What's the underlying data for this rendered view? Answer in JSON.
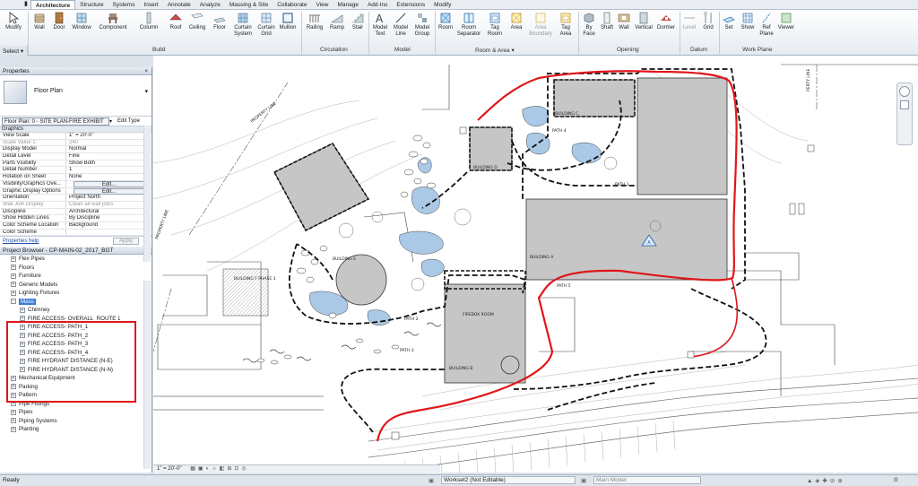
{
  "tabs": [
    "Architecture",
    "Structure",
    "Systems",
    "Insert",
    "Annotate",
    "Analyze",
    "Massing & Site",
    "Collaborate",
    "View",
    "Manage",
    "Add-Ins",
    "Extensions",
    "Modify"
  ],
  "ribbon": {
    "buttons": {
      "modify": "Modify",
      "wall": "Wall",
      "door": "Door",
      "window": "Window",
      "component": "Component",
      "column": "Column",
      "roof": "Roof",
      "ceiling": "Ceiling",
      "floor": "Floor",
      "curtain_system": "Curtain System",
      "curtain_grid": "Curtain Grid",
      "mullion": "Mullion",
      "railing": "Railing",
      "ramp": "Ramp",
      "stair": "Stair",
      "model_text": "Model Text",
      "model_line": "Model Line",
      "model_group": "Model Group",
      "room": "Room",
      "room_separator": "Room Separator",
      "tag_room": "Tag Room",
      "area": "Area",
      "area_boundary": "Area Boundary",
      "tag_area": "Tag Area",
      "by_face": "By Face",
      "shaft": "Shaft",
      "wall_open": "Wall",
      "vertical": "Vertical",
      "dormer": "Dormer",
      "level": "Level",
      "grid": "Grid",
      "set": "Set",
      "show": "Show",
      "ref_plane": "Ref Plane",
      "viewer": "Viewer"
    },
    "panels": {
      "select": "Select ▾",
      "build": "Build",
      "circulation": "Circulation",
      "model": "Model",
      "room_area": "Room & Area ▾",
      "opening": "Opening",
      "datum": "Datum",
      "work_plane": "Work Plane"
    }
  },
  "properties": {
    "title": "Properties",
    "close": "×",
    "type_name": "Floor Plan",
    "instance": "Floor Plan: 0 - SITE PLAN-FIRE EXHIBIT",
    "edit_type": "Edit Type",
    "section": "Graphics",
    "rows": [
      {
        "k": "View Scale",
        "v": "1\" = 20'-0\""
      },
      {
        "k": "Scale Value    1:",
        "v": "240",
        "disabled": true
      },
      {
        "k": "Display Model",
        "v": "Normal"
      },
      {
        "k": "Detail Level",
        "v": "Fine"
      },
      {
        "k": "Parts Visibility",
        "v": "Show Both"
      },
      {
        "k": "Detail Number",
        "v": "1"
      },
      {
        "k": "Rotation on Sheet",
        "v": "None"
      },
      {
        "k": "Visibility/Graphics Ove...",
        "v": "Edit...",
        "button": true
      },
      {
        "k": "Graphic Display Options",
        "v": "Edit...",
        "button": true
      },
      {
        "k": "Orientation",
        "v": "Project North"
      },
      {
        "k": "Wall Join Display",
        "v": "Clean all wall joins",
        "disabled": true
      },
      {
        "k": "Discipline",
        "v": "Architectural"
      },
      {
        "k": "Show Hidden Lines",
        "v": "By Discipline"
      },
      {
        "k": "Color Scheme Location",
        "v": "Background"
      },
      {
        "k": "Color Scheme",
        "v": ""
      }
    ],
    "help_link": "Properties help",
    "apply": "Apply"
  },
  "project_browser": {
    "title": "Project Browser - CP-MAIN-02_2017_BGT",
    "close": "×",
    "items": [
      {
        "label": "Flex Pipes",
        "level": 1,
        "pm": "+"
      },
      {
        "label": "Floors",
        "level": 1,
        "pm": "+"
      },
      {
        "label": "Furniture",
        "level": 1,
        "pm": "+"
      },
      {
        "label": "Generic Models",
        "level": 1,
        "pm": "+"
      },
      {
        "label": "Lighting Fixtures",
        "level": 1,
        "pm": "+"
      },
      {
        "label": "Mass",
        "level": 1,
        "pm": "−",
        "selected": true
      },
      {
        "label": "Chimney",
        "level": 2,
        "pm": "+"
      },
      {
        "label": "FIRE ACCESS- OVERALL_ROUTE 1",
        "level": 2,
        "pm": "+"
      },
      {
        "label": "FIRE ACCESS- PATH_1",
        "level": 2,
        "pm": "+"
      },
      {
        "label": "FIRE ACCESS- PATH_2",
        "level": 2,
        "pm": "+"
      },
      {
        "label": "FIRE ACCESS- PATH_3",
        "level": 2,
        "pm": "+"
      },
      {
        "label": "FIRE ACCESS- PATH_4",
        "level": 2,
        "pm": "+"
      },
      {
        "label": "FIRE HYDRANT DISTANCE (N-E)",
        "level": 2,
        "pm": "+"
      },
      {
        "label": "FIRE HYDRANT DISTANCE (N-N)",
        "level": 2,
        "pm": "+"
      },
      {
        "label": "Mechanical Equipment",
        "level": 1,
        "pm": "+"
      },
      {
        "label": "Parking",
        "level": 1,
        "pm": "+"
      },
      {
        "label": "Pattern",
        "level": 1,
        "pm": "+"
      },
      {
        "label": "Pipe Fittings",
        "level": 1,
        "pm": "+"
      },
      {
        "label": "Pipes",
        "level": 1,
        "pm": "+"
      },
      {
        "label": "Piping Systems",
        "level": 1,
        "pm": "+"
      },
      {
        "label": "Planting",
        "level": 1,
        "pm": "+"
      }
    ]
  },
  "drawing_labels": {
    "property_line_1": "PROPERTY LINE",
    "property_line_2": "PROPERTY LINE",
    "property_line_3": "PERTY LINE",
    "building_a": "BUILDING A",
    "building_b": "BUILDING B",
    "building_c": "BUILDING C",
    "building_d": "BUILDING D",
    "building_e": "BUILDING E",
    "building_f": "BUILDING F PHASE 3",
    "firebox": "FIREBOX ROOM",
    "path1": "PATH 1",
    "path2": "PATH 2",
    "path3": "PATH 3",
    "path4": "PATH 4",
    "path5": "PATH 5"
  },
  "view_control": {
    "scale": "1\" = 20'-0\""
  },
  "status": {
    "ready": "Ready",
    "workset": "Workset2 (Not Editable)",
    "model": "Main Model",
    "zero": ":0"
  },
  "colors": {
    "red_highlight": "#e0161a",
    "building_fill": "#c6c6c6",
    "pond_fill": "#a9c9e6"
  }
}
